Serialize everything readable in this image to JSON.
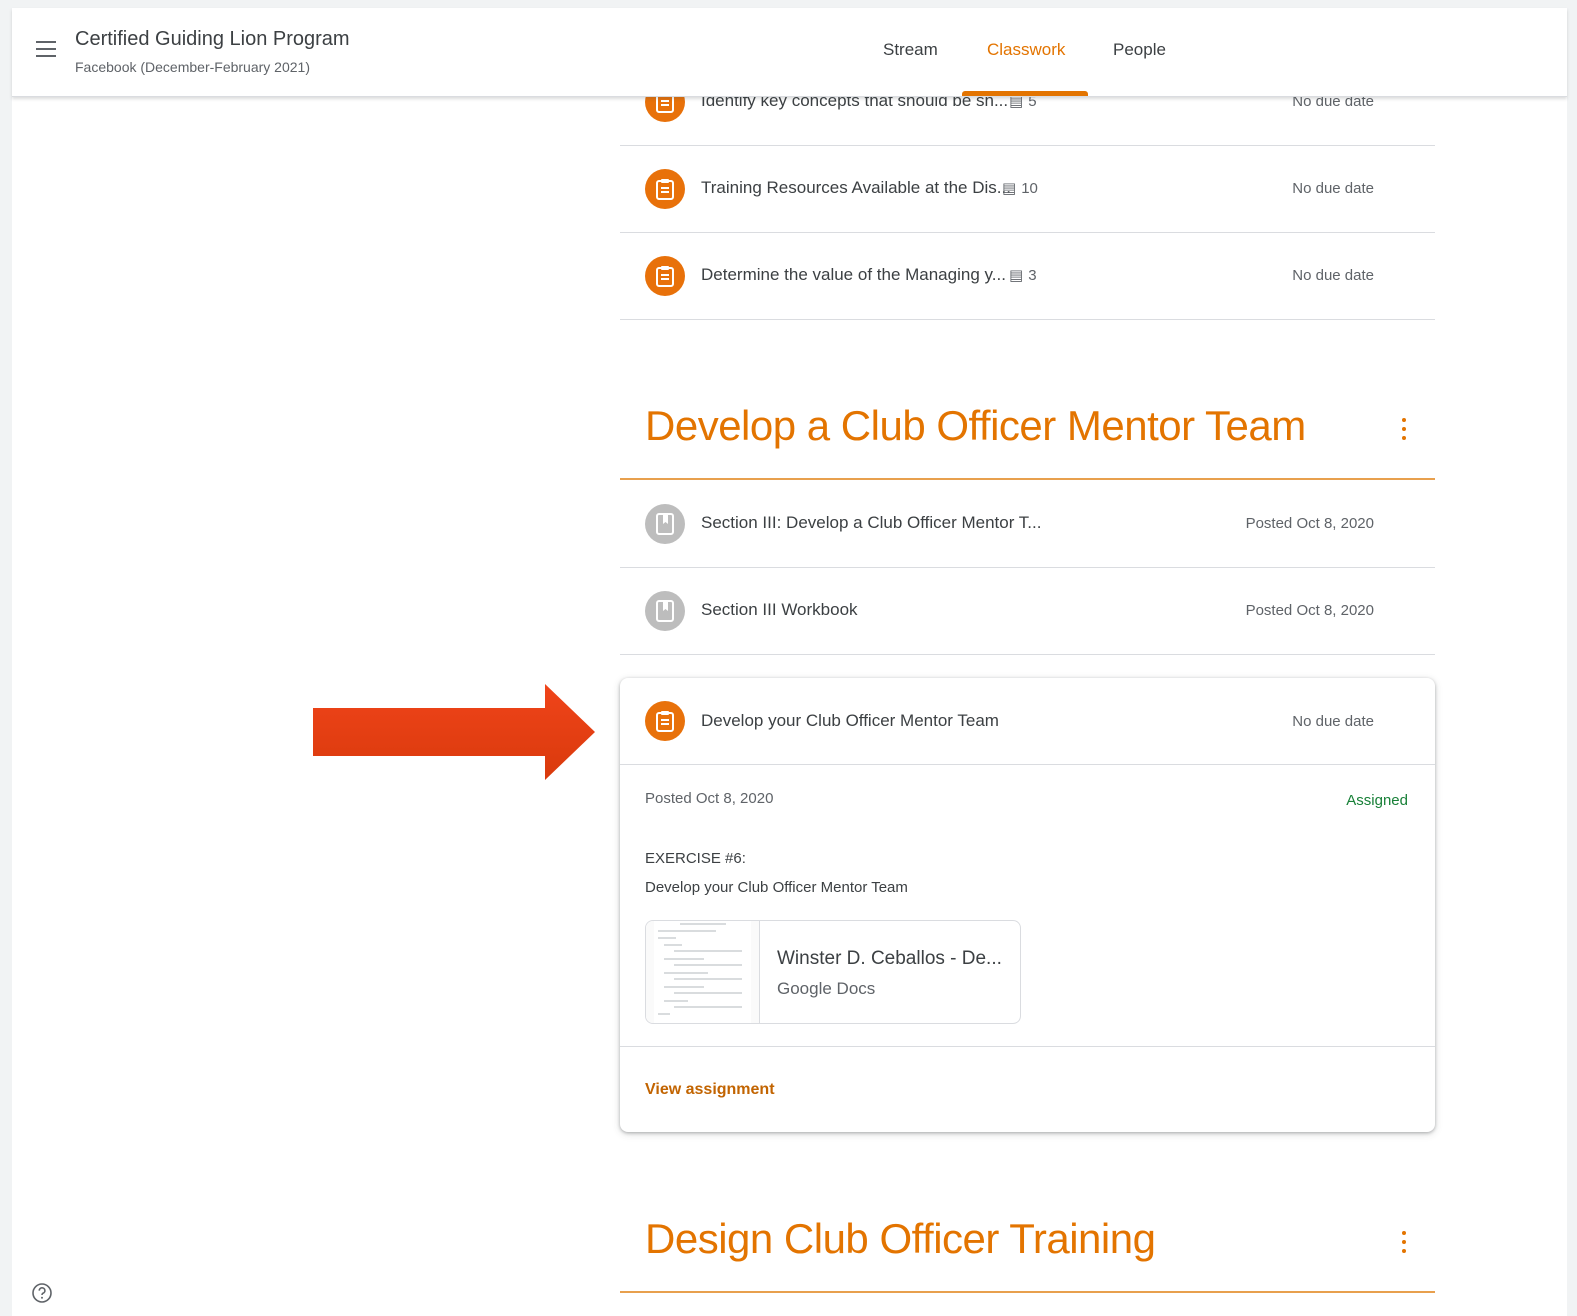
{
  "header": {
    "class_title": "Certified Guiding Lion Program",
    "class_section": "Facebook (December-February 2021)",
    "tabs": [
      {
        "label": "Stream",
        "active": false
      },
      {
        "label": "Classwork",
        "active": true
      },
      {
        "label": "People",
        "active": false
      }
    ]
  },
  "colors": {
    "accent": "#e37400",
    "assignment_icon": "#e8710a",
    "material_icon": "#bdbdbd",
    "assigned": "#188038"
  },
  "top_items": [
    {
      "title": "Identify key concepts that should be sh...",
      "comments": "5",
      "due": "No due date",
      "icon": "assignment-icon"
    },
    {
      "title": "Training Resources Available at the Dis...",
      "comments": "10",
      "due": "No due date",
      "icon": "assignment-icon"
    },
    {
      "title": "Determine the value of the Managing y...",
      "comments": "3",
      "due": "No due date",
      "icon": "assignment-icon"
    }
  ],
  "topic1": {
    "title": "Develop a Club Officer Mentor Team",
    "materials": [
      {
        "title": "Section III: Develop a Club Officer Mentor T...",
        "posted": "Posted Oct 8, 2020",
        "icon": "material-icon"
      },
      {
        "title": "Section III Workbook",
        "posted": "Posted Oct 8, 2020",
        "icon": "material-icon"
      }
    ],
    "expanded_assignment": {
      "title": "Develop your Club Officer Mentor Team",
      "due": "No due date",
      "posted": "Posted Oct 8, 2020",
      "status": "Assigned",
      "description_line1": "EXERCISE #6:",
      "description_line2": "Develop your Club Officer Mentor Team",
      "attachment": {
        "name": "Winster D. Ceballos - De...",
        "type": "Google Docs"
      },
      "view_link": "View assignment"
    }
  },
  "topic2": {
    "title": "Design Club Officer Training"
  }
}
